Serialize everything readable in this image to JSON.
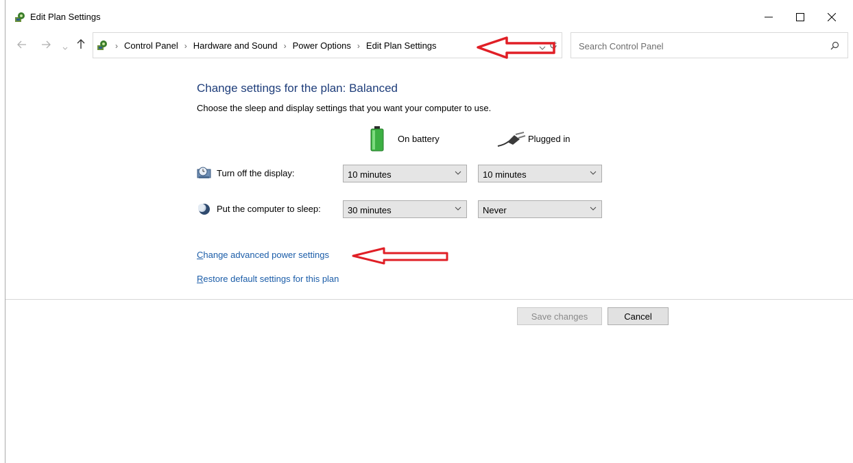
{
  "window": {
    "title": "Edit Plan Settings"
  },
  "address_bar": {
    "breadcrumbs": [
      "Control Panel",
      "Hardware and Sound",
      "Power Options",
      "Edit Plan Settings"
    ]
  },
  "search": {
    "placeholder": "Search Control Panel"
  },
  "main": {
    "heading": "Change settings for the plan: Balanced",
    "subtitle": "Choose the sleep and display settings that you want your computer to use.",
    "columns": {
      "battery": "On battery",
      "plugged": "Plugged in"
    },
    "rows": [
      {
        "label": "Turn off the display:",
        "on_battery": "10 minutes",
        "plugged_in": "10 minutes"
      },
      {
        "label": "Put the computer to sleep:",
        "on_battery": "30 minutes",
        "plugged_in": "Never"
      }
    ],
    "links": {
      "advanced_first": "C",
      "advanced_rest": "hange advanced power settings",
      "restore_first": "R",
      "restore_rest": "estore default settings for this plan"
    }
  },
  "buttons": {
    "save": "Save changes",
    "cancel": "Cancel"
  },
  "colors": {
    "heading": "#1e3d7a",
    "link": "#1a5ca8",
    "annotation_arrow": "#e01f26",
    "battery": "#3cb043"
  },
  "icons": [
    "control-panel-icon",
    "monitor-clock-icon",
    "moon-icon",
    "battery-icon",
    "power-plug-icon",
    "search-icon"
  ]
}
